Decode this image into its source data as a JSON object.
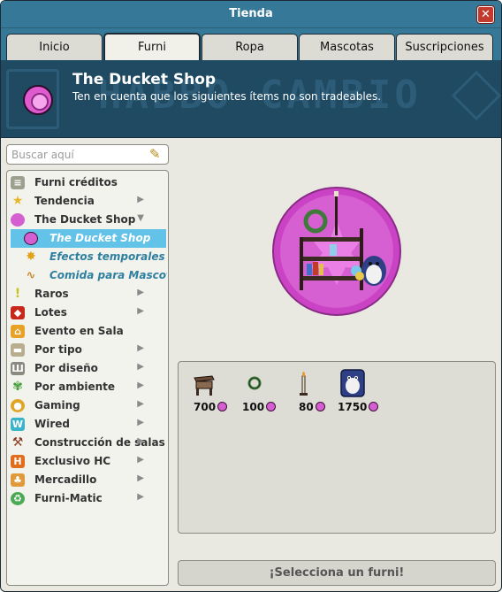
{
  "window": {
    "title": "Tienda"
  },
  "tabs": [
    {
      "label": "Inicio"
    },
    {
      "label": "Furni"
    },
    {
      "label": "Ropa"
    },
    {
      "label": "Mascotas"
    },
    {
      "label": "Suscripciones"
    }
  ],
  "active_tab": "Furni",
  "banner": {
    "background_text": "HABBO CAMBIO",
    "heading": "The Ducket Shop",
    "subheading": "Ten en cuenta que los siguientes ítems no son tradeables."
  },
  "search": {
    "placeholder": "Buscar aquí",
    "icon": "pencil-icon"
  },
  "nav": {
    "items": [
      {
        "label": "Furni créditos",
        "icon": "coins-icon",
        "has_children": false
      },
      {
        "label": "Tendencia",
        "icon": "star-icon",
        "has_children": true
      },
      {
        "label": "The Ducket Shop",
        "icon": "ducket-icon",
        "has_children": true,
        "expanded": true
      },
      {
        "label": "The Ducket Shop",
        "icon": "ducket-icon",
        "child": true,
        "selected": true
      },
      {
        "label": "Efectos temporales (Duc",
        "icon": "sparkle-icon",
        "child": true
      },
      {
        "label": "Comida para Mascotas (",
        "icon": "bone-icon",
        "child": true
      },
      {
        "label": "Raros",
        "icon": "exclamation-icon",
        "has_children": true
      },
      {
        "label": "Lotes",
        "icon": "box-icon",
        "has_children": true
      },
      {
        "label": "Evento en Sala",
        "icon": "event-icon",
        "has_children": false
      },
      {
        "label": "Por tipo",
        "icon": "sofa-icon",
        "has_children": true
      },
      {
        "label": "Por diseño",
        "icon": "columns-icon",
        "has_children": true
      },
      {
        "label": "Por ambiente",
        "icon": "plant-icon",
        "has_children": true
      },
      {
        "label": "Gaming",
        "icon": "medal-icon",
        "has_children": true
      },
      {
        "label": "Wired",
        "icon": "wired-icon",
        "has_children": true
      },
      {
        "label": "Construcción de salas",
        "icon": "hammer-icon",
        "has_children": true
      },
      {
        "label": "Exclusivo HC",
        "icon": "hc-icon",
        "has_children": true
      },
      {
        "label": "Mercadillo",
        "icon": "market-icon",
        "has_children": true
      },
      {
        "label": "Furni-Matic",
        "icon": "recycle-icon",
        "has_children": true
      }
    ]
  },
  "products": [
    {
      "icon": "desk-icon",
      "price": "700"
    },
    {
      "icon": "wreath-icon",
      "price": "100"
    },
    {
      "icon": "candle-icon",
      "price": "80"
    },
    {
      "icon": "penguin-icon",
      "price": "1750"
    }
  ],
  "select_button": {
    "label": "¡Selecciona un furni!"
  },
  "colors": {
    "header_blue": "#367897",
    "banner_blue": "#1f4a62",
    "selected_row": "#62c2e8",
    "ducket_pink": "#d55ed0",
    "close_red": "#c13a2d"
  }
}
